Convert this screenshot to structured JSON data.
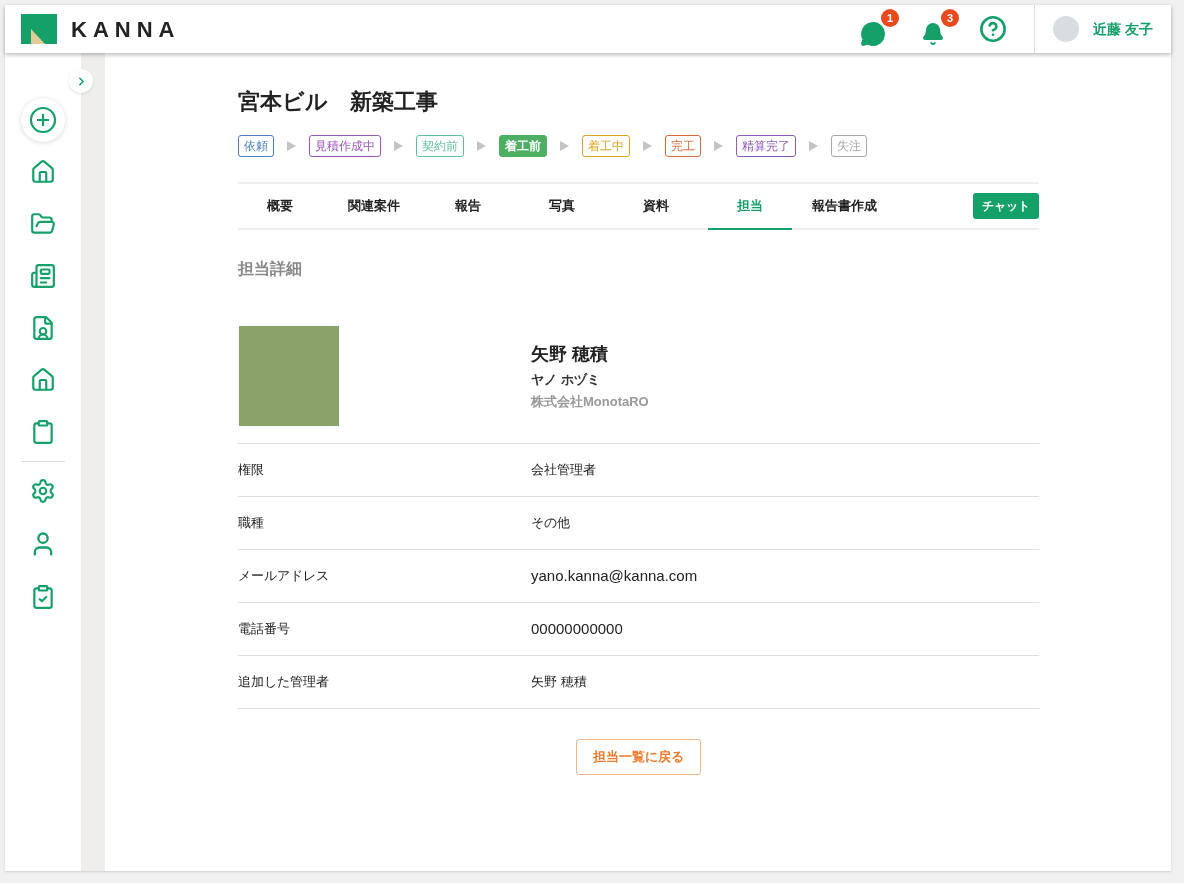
{
  "header": {
    "logo": "KANNA",
    "chat_badge": "1",
    "bell_badge": "3",
    "user": "近藤 友子"
  },
  "project": {
    "title": "宮本ビル　新築工事",
    "statuses": [
      {
        "label": "依頼",
        "color": "#4a7fc0",
        "selected": false
      },
      {
        "label": "見積作成中",
        "color": "#9b59b6",
        "selected": false
      },
      {
        "label": "契約前",
        "color": "#5cbf9a",
        "selected": false
      },
      {
        "label": "着工前",
        "color": "#4caf63",
        "selected": true
      },
      {
        "label": "着工中",
        "color": "#d9a520",
        "selected": false
      },
      {
        "label": "完工",
        "color": "#d9693a",
        "selected": false
      },
      {
        "label": "精算完了",
        "color": "#8e5cb8",
        "selected": false
      },
      {
        "label": "失注",
        "color": "#a8a8a8",
        "selected": false
      }
    ]
  },
  "tabs": [
    {
      "label": "概要",
      "selected": false
    },
    {
      "label": "関連案件",
      "selected": false
    },
    {
      "label": "報告",
      "selected": false
    },
    {
      "label": "写真",
      "selected": false
    },
    {
      "label": "資料",
      "selected": false
    },
    {
      "label": "担当",
      "selected": true
    },
    {
      "label": "報告書作成",
      "selected": false
    }
  ],
  "chat_button": "チャット",
  "section_title": "担当詳細",
  "person": {
    "name": "矢野 穂積",
    "kana": "ヤノ ホヅミ",
    "company": "株式会社MonotaRO"
  },
  "details": [
    {
      "label": "権限",
      "value": "会社管理者"
    },
    {
      "label": "職種",
      "value": "その他"
    },
    {
      "label": "メールアドレス",
      "value": "yano.kanna@kanna.com"
    },
    {
      "label": "電話番号",
      "value": "00000000000"
    },
    {
      "label": "追加した管理者",
      "value": "矢野 穂積"
    }
  ],
  "back_button": "担当一覧に戻る"
}
